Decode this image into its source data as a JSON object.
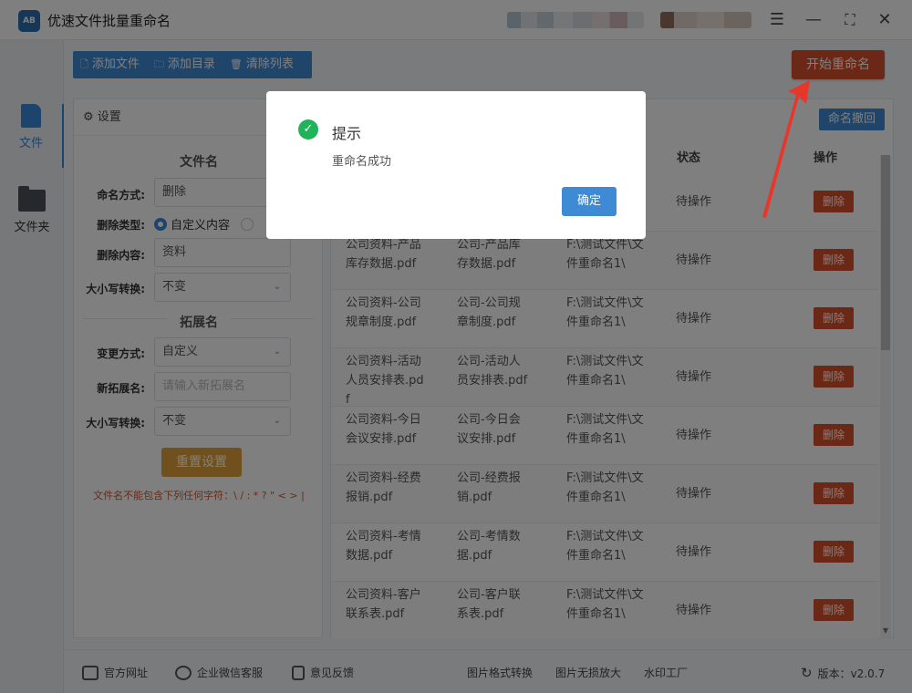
{
  "app": {
    "title": "优速文件批量重命名",
    "logo_text": "AB"
  },
  "toolbar": {
    "add_file": "添加文件",
    "add_dir": "添加目录",
    "clear_list": "清除列表",
    "start": "开始重命名"
  },
  "nav": {
    "files": "文件",
    "folder": "文件夹"
  },
  "settings": {
    "header": "设置",
    "filename_section": "文件名",
    "naming_mode_label": "命名方式:",
    "naming_mode_value": "删除",
    "delete_type_label": "删除类型:",
    "delete_type_option1": "自定义内容",
    "delete_content_label": "删除内容:",
    "delete_content_value": "资料",
    "case_label": "大小写转换:",
    "case_value": "不变",
    "ext_section": "拓展名",
    "change_mode_label": "变更方式:",
    "change_mode_value": "自定义",
    "new_ext_label": "新拓展名:",
    "new_ext_placeholder": "请输入新拓展名",
    "ext_case_label": "大小写转换:",
    "ext_case_value": "不变",
    "reset": "重置设置",
    "warning": "文件名不能包含下列任何字符：\\ / : * ? \" < > |"
  },
  "table": {
    "undo": "命名撤回",
    "col_status": "状态",
    "col_action": "操作",
    "rows": [
      {
        "orig": "",
        "new": "",
        "path": "",
        "status": "待操作",
        "action": "删除"
      },
      {
        "orig": "公司资料-产品库存数据.pdf",
        "new": "公司-产品库存数据.pdf",
        "path": "F:\\测试文件\\文件重命名1\\",
        "status": "待操作",
        "action": "删除"
      },
      {
        "orig": "公司资料-公司规章制度.pdf",
        "new": "公司-公司规章制度.pdf",
        "path": "F:\\测试文件\\文件重命名1\\",
        "status": "待操作",
        "action": "删除"
      },
      {
        "orig": "公司资料-活动人员安排表.pdf",
        "new": "公司-活动人员安排表.pdf",
        "path": "F:\\测试文件\\文件重命名1\\",
        "status": "待操作",
        "action": "删除"
      },
      {
        "orig": "公司资料-今日会议安排.pdf",
        "new": "公司-今日会议安排.pdf",
        "path": "F:\\测试文件\\文件重命名1\\",
        "status": "待操作",
        "action": "删除"
      },
      {
        "orig": "公司资料-经费报销.pdf",
        "new": "公司-经费报销.pdf",
        "path": "F:\\测试文件\\文件重命名1\\",
        "status": "待操作",
        "action": "删除"
      },
      {
        "orig": "公司资料-考情数据.pdf",
        "new": "公司-考情数据.pdf",
        "path": "F:\\测试文件\\文件重命名1\\",
        "status": "待操作",
        "action": "删除"
      },
      {
        "orig": "公司资料-客户联系表.pdf",
        "new": "公司-客户联系表.pdf",
        "path": "F:\\测试文件\\文件重命名1\\",
        "status": "待操作",
        "action": "删除"
      }
    ]
  },
  "footer": {
    "website": "官方网址",
    "wechat": "企业微信客服",
    "feedback": "意见反馈",
    "img_convert": "图片格式转换",
    "img_enlarge": "图片无损放大",
    "watermark": "水印工厂",
    "version": "版本：v2.0.7"
  },
  "modal": {
    "title": "提示",
    "message": "重命名成功",
    "ok": "确定"
  },
  "colors": {
    "primary": "#3f8ad4",
    "danger": "#d8502c",
    "success": "#21b35a",
    "warning": "#e0a13a"
  }
}
